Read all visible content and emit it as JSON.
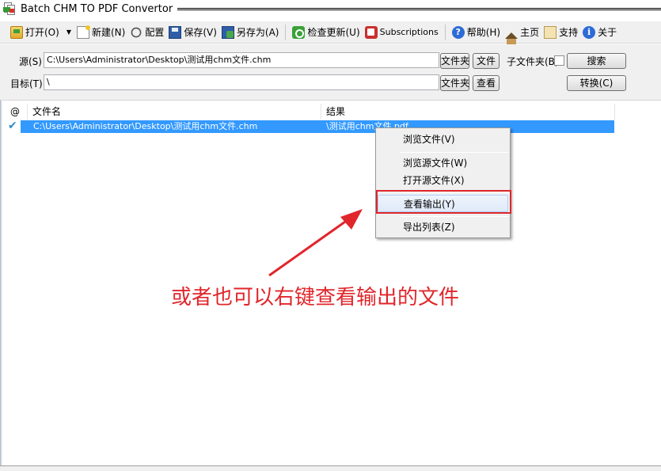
{
  "window": {
    "title": "Batch CHM TO PDF Convertor"
  },
  "toolbar": {
    "open": "打开(O)",
    "new": "新建(N)",
    "config": "配置",
    "save": "保存(V)",
    "saveas": "另存为(A)",
    "update": "检查更新(U)",
    "subscriptions": "Subscriptions",
    "help": "帮助(H)",
    "home": "主页",
    "support": "支持",
    "about": "关于"
  },
  "form": {
    "source_label": "源(S)",
    "source_value": "C:\\Users\\Administrator\\Desktop\\测试用chm文件.chm",
    "target_label": "目标(T)",
    "target_value": "\\",
    "folder_btn": "文件夹",
    "file_btn": "文件",
    "folder_btn2": "文件夹",
    "view_btn": "查看",
    "subfolder_label": "子文件夹(B)",
    "search_btn": "搜索",
    "convert_btn": "转换(C)"
  },
  "list": {
    "columns": [
      "@",
      "文件名",
      "结果"
    ],
    "rows": [
      {
        "file": "C:\\Users\\Administrator\\Desktop\\测试用chm文件.chm",
        "result": "\\测试用chm文件.pdf"
      }
    ]
  },
  "context_menu": {
    "items": [
      "浏览文件(V)",
      "浏览源文件(W)",
      "打开源文件(X)",
      "查看输出(Y)",
      "导出列表(Z)"
    ],
    "highlighted": "查看输出(Y)"
  },
  "annotation": {
    "text": "或者也可以右键查看输出的文件",
    "color": "#e0262b"
  },
  "colors": {
    "selection": "#3399ff",
    "annotation": "#e0262b"
  }
}
